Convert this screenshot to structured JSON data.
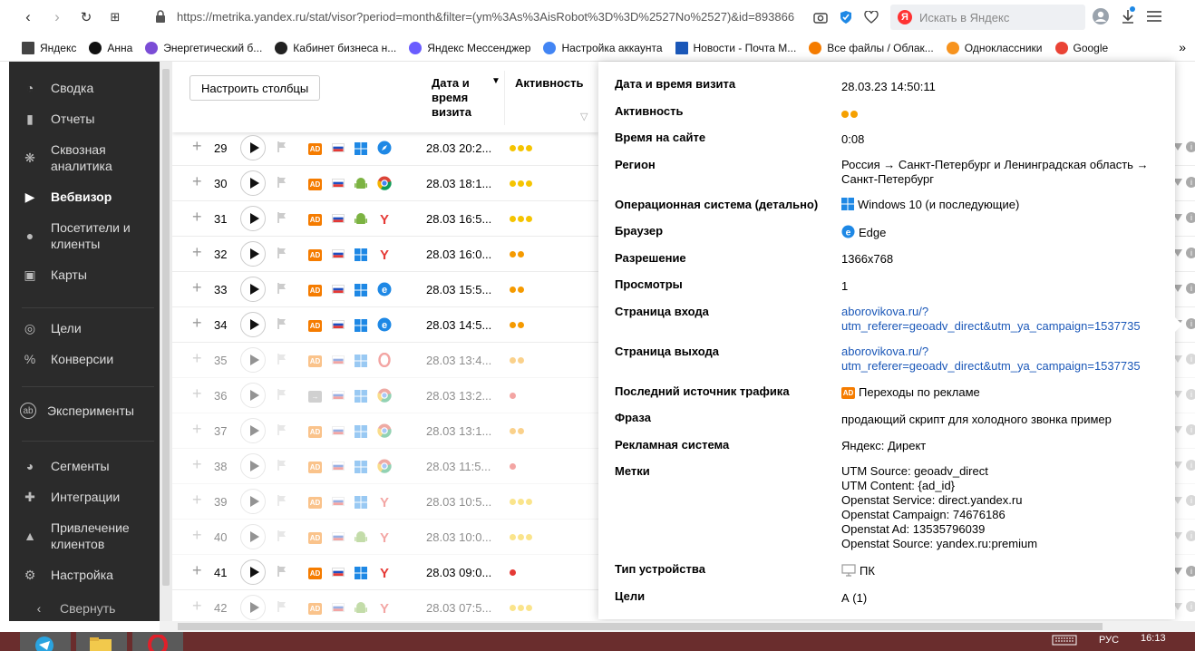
{
  "browser": {
    "url": "https://metrika.yandex.ru/stat/visor?period=month&filter=(ym%3As%3AisRobot%3D%3D%2527No%2527)&id=893866",
    "search_placeholder": "Искать в Яндекс",
    "search_logo": "Я"
  },
  "bookmarks": [
    {
      "label": "Яндекс",
      "icon": "doc-icon",
      "color": "#444444"
    },
    {
      "label": "Анна",
      "icon": "plus-circle-icon",
      "color": "#111111"
    },
    {
      "label": "Энергетический б...",
      "icon": "globe-icon",
      "color": "#7b4dd6"
    },
    {
      "label": "Кабинет бизнеса н...",
      "icon": "yandex-icon",
      "color": "#222222"
    },
    {
      "label": "Яндекс Мессенджер",
      "icon": "messenger-icon",
      "color": "#6a5cff"
    },
    {
      "label": "Настройка аккаунта",
      "icon": "google-account-icon",
      "color": "#4285f4"
    },
    {
      "label": "Новости - Почта М...",
      "icon": "mail-icon",
      "color": "#1a57b8"
    },
    {
      "label": "Все файлы / Облак...",
      "icon": "cloud-icon",
      "color": "#f57c00"
    },
    {
      "label": "Одноклассники",
      "icon": "ok-icon",
      "color": "#f7931e"
    },
    {
      "label": "Google",
      "icon": "google-icon",
      "color": "#ea4335"
    }
  ],
  "bookmarks_more": "»",
  "nav": [
    {
      "label": "Сводка",
      "icon": "gauge-icon"
    },
    {
      "label": "Отчеты",
      "icon": "bar-chart-icon"
    },
    {
      "label": "Сквозная аналитика",
      "icon": "asterisk-icon"
    },
    {
      "label": "Вебвизор",
      "icon": "play-icon",
      "active": true
    },
    {
      "label": "Посетители и клиенты",
      "icon": "person-icon"
    },
    {
      "label": "Карты",
      "icon": "map-icon"
    },
    {
      "label": "Цели",
      "icon": "target-icon"
    },
    {
      "label": "Конверсии",
      "icon": "percent-icon"
    },
    {
      "label": "Эксперименты",
      "icon": "ab-icon"
    },
    {
      "label": "Сегменты",
      "icon": "pie-icon"
    },
    {
      "label": "Интеграции",
      "icon": "puzzle-icon"
    },
    {
      "label": "Привлечение клиентов",
      "icon": "flame-icon"
    },
    {
      "label": "Настройка",
      "icon": "gear-icon"
    }
  ],
  "nav_collapse": "Свернуть",
  "table": {
    "configure_button": "Настроить столбцы",
    "col_datetime": "Дата и время визита",
    "col_activity": "Активность",
    "rows": [
      {
        "num": "29",
        "date": "28.03 20:2...",
        "dots": 3,
        "dot_color": "#f5c400",
        "os": "windows-phone",
        "browser": "safari",
        "dim": false
      },
      {
        "num": "30",
        "date": "28.03 18:1...",
        "dots": 3,
        "dot_color": "#f5c400",
        "os": "android",
        "browser": "chrome",
        "dim": false
      },
      {
        "num": "31",
        "date": "28.03 16:5...",
        "dots": 3,
        "dot_color": "#f5c400",
        "os": "android",
        "browser": "yandex",
        "dim": false
      },
      {
        "num": "32",
        "date": "28.03 16:0...",
        "dots": 2,
        "dot_color": "#f59a00",
        "os": "windows",
        "browser": "yandex",
        "dim": false
      },
      {
        "num": "33",
        "date": "28.03 15:5...",
        "dots": 2,
        "dot_color": "#f59a00",
        "os": "windows",
        "browser": "edge",
        "dim": false
      },
      {
        "num": "34",
        "date": "28.03 14:5...",
        "dots": 2,
        "dot_color": "#f59a00",
        "os": "windows",
        "browser": "edge",
        "dim": false
      },
      {
        "num": "35",
        "date": "28.03 13:4...",
        "dots": 2,
        "dot_color": "#f59a00",
        "os": "windows",
        "browser": "opera",
        "dim": true
      },
      {
        "num": "36",
        "date": "28.03 13:2...",
        "dots": 1,
        "dot_color": "#e53935",
        "os": "windows",
        "browser": "chrome",
        "dim": true,
        "source": "link"
      },
      {
        "num": "37",
        "date": "28.03 13:1...",
        "dots": 2,
        "dot_color": "#f59a00",
        "os": "windows",
        "browser": "chrome",
        "dim": true
      },
      {
        "num": "38",
        "date": "28.03 11:5...",
        "dots": 1,
        "dot_color": "#e53935",
        "os": "windows",
        "browser": "chrome",
        "dim": true
      },
      {
        "num": "39",
        "date": "28.03 10:5...",
        "dots": 3,
        "dot_color": "#f5c400",
        "os": "windows",
        "browser": "yandex",
        "dim": true
      },
      {
        "num": "40",
        "date": "28.03 10:0...",
        "dots": 3,
        "dot_color": "#f5c400",
        "os": "android",
        "browser": "yandex",
        "dim": true
      },
      {
        "num": "41",
        "date": "28.03 09:0...",
        "dots": 1,
        "dot_color": "#e53935",
        "os": "windows",
        "browser": "yandex",
        "dim": false
      },
      {
        "num": "42",
        "date": "28.03 07:5...",
        "dots": 3,
        "dot_color": "#f5c400",
        "os": "android",
        "browser": "yandex",
        "dim": true
      }
    ]
  },
  "detail": {
    "visit_datetime_label": "Дата и время визита",
    "visit_datetime": "28.03.23 14:50:11",
    "activity_label": "Активность",
    "activity_dots": 2,
    "time_on_site_label": "Время на сайте",
    "time_on_site": "0:08",
    "region_label": "Регион",
    "region": "Россия → Санкт-Петербург и Ленинградская область → Санкт-Петербург",
    "os_label": "Операционная система (детально)",
    "os": "Windows 10 (и последующие)",
    "browser_label": "Браузер",
    "browser": "Edge",
    "resolution_label": "Разрешение",
    "resolution": "1366x768",
    "views_label": "Просмотры",
    "views": "1",
    "entry_label": "Страница входа",
    "entry_line1": "aborovikova.ru/?",
    "entry_line2": "utm_referer=geoadv_direct&utm_ya_campaign=1537735",
    "exit_label": "Страница выхода",
    "exit_line1": "aborovikova.ru/?",
    "exit_line2": "utm_referer=geoadv_direct&utm_ya_campaign=1537735",
    "source_label": "Последний источник трафика",
    "source": "Переходы по рекламе",
    "phrase_label": "Фраза",
    "phrase": "продающий скрипт для холодного звонка пример",
    "adsystem_label": "Рекламная система",
    "adsystem": "Яндекс: Директ",
    "tags_label": "Метки",
    "tags": [
      "UTM Source: geoadv_direct",
      "UTM Content: {ad_id}",
      "Openstat Service: direct.yandex.ru",
      "Openstat Campaign: 74676186",
      "Openstat Ad: 13535796039",
      "Openstat Source: yandex.ru:premium"
    ],
    "device_label": "Тип устройства",
    "device": "ПК",
    "goals_label": "Цели",
    "goals": "А (1)"
  },
  "taskbar": {
    "lang": "РУС",
    "time": "16:13"
  }
}
